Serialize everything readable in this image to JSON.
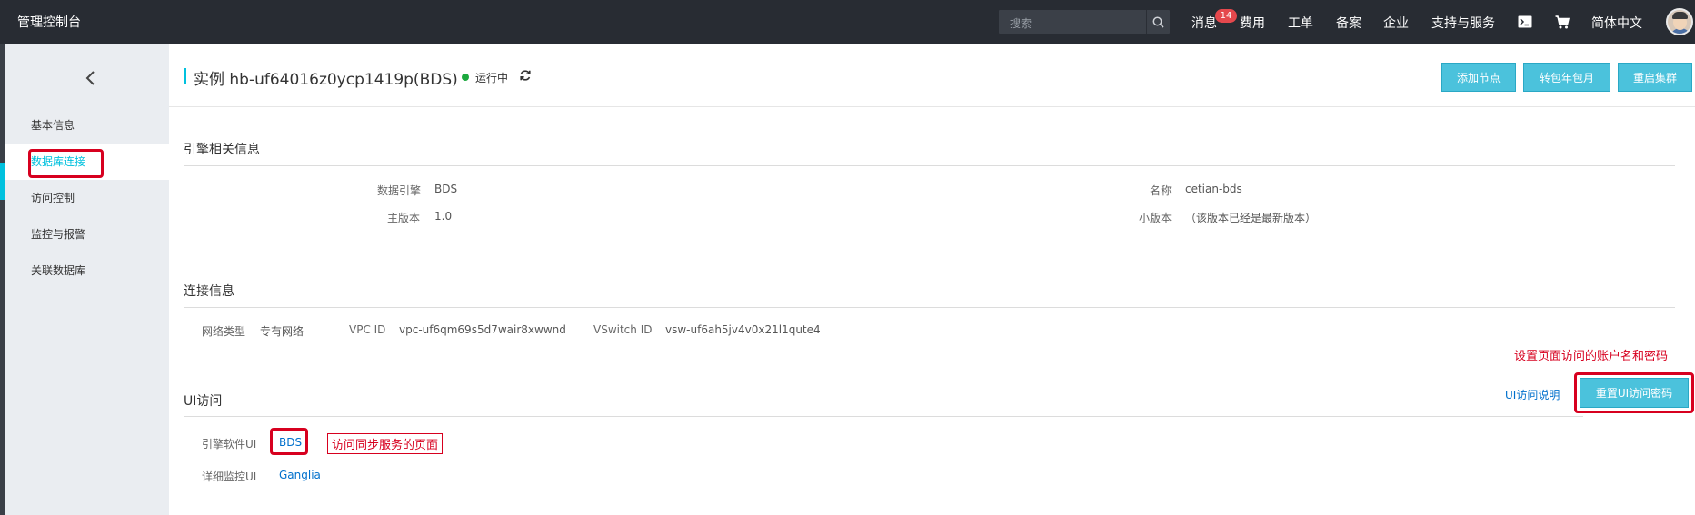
{
  "topbar": {
    "brand": "管理控制台",
    "search_placeholder": "搜索",
    "messages_label": "消息",
    "messages_badge": "14",
    "nav": [
      "费用",
      "工单",
      "备案",
      "企业",
      "支持与服务"
    ],
    "language": "简体中文"
  },
  "sidebar": {
    "items": [
      {
        "label": "基本信息"
      },
      {
        "label": "数据库连接"
      },
      {
        "label": "访问控制"
      },
      {
        "label": "监控与报警"
      },
      {
        "label": "关联数据库"
      }
    ]
  },
  "header": {
    "title": "实例 hb-uf64016z0ycp1419p(BDS)",
    "status": "运行中",
    "buttons": [
      "添加节点",
      "转包年包月",
      "重启集群"
    ]
  },
  "engine": {
    "section_title": "引擎相关信息",
    "engine_label": "数据引擎",
    "engine_value": "BDS",
    "major_label": "主版本",
    "major_value": "1.0",
    "name_label": "名称",
    "name_value": "cetian-bds",
    "minor_label": "小版本",
    "minor_value": "（该版本已经是最新版本）"
  },
  "connection": {
    "section_title": "连接信息",
    "network_label": "网络类型",
    "network_value": "专有网络",
    "vpc_label": "VPC ID",
    "vpc_value": "vpc-uf6qm69s5d7wair8xwwnd",
    "vswitch_label": "VSwitch ID",
    "vswitch_value": "vsw-uf6ah5jv4v0x21l1qute4"
  },
  "ui_access": {
    "section_title": "UI访问",
    "help_link": "UI访问说明",
    "reset_button": "重置UI访问密码",
    "annotation_reset": "设置页面访问的账户名和密码",
    "engine_ui_label": "引擎软件UI",
    "engine_ui_link": "BDS",
    "annotation_bds": "访问同步服务的页面",
    "monitor_ui_label": "详细监控UI",
    "monitor_ui_link": "Ganglia"
  },
  "colors": {
    "accent": "#00c1de",
    "button": "#4bc2dc",
    "annotation": "#d7001f",
    "topbar": "#282c33",
    "status_running": "#1ca93e"
  }
}
